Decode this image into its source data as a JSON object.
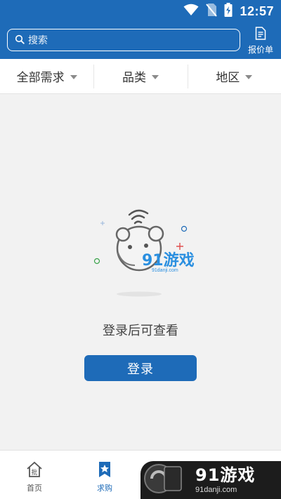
{
  "status_bar": {
    "time": "12:57",
    "icons": [
      "wifi-icon",
      "no-sim-icon",
      "battery-charging-icon"
    ]
  },
  "header": {
    "search_placeholder": "搜索",
    "search_icon": "search-icon",
    "quote_label": "报价单",
    "quote_icon": "document-icon"
  },
  "filters": [
    {
      "label": "全部需求"
    },
    {
      "label": "品类"
    },
    {
      "label": "地区"
    }
  ],
  "empty_state": {
    "message": "登录后可查看",
    "illustration_text": "91游戏",
    "illustration_url": "91danji.com"
  },
  "login_button": {
    "label": "登录"
  },
  "bottom_nav": {
    "items": [
      {
        "label": "首页",
        "icon": "home-icon",
        "active": false
      },
      {
        "label": "求购",
        "icon": "star-bookmark-icon",
        "active": true
      }
    ]
  },
  "watermark": {
    "brand": "91游戏",
    "url": "91danji.com"
  },
  "colors": {
    "primary": "#1e6bb8",
    "background": "#f2f2f2"
  }
}
